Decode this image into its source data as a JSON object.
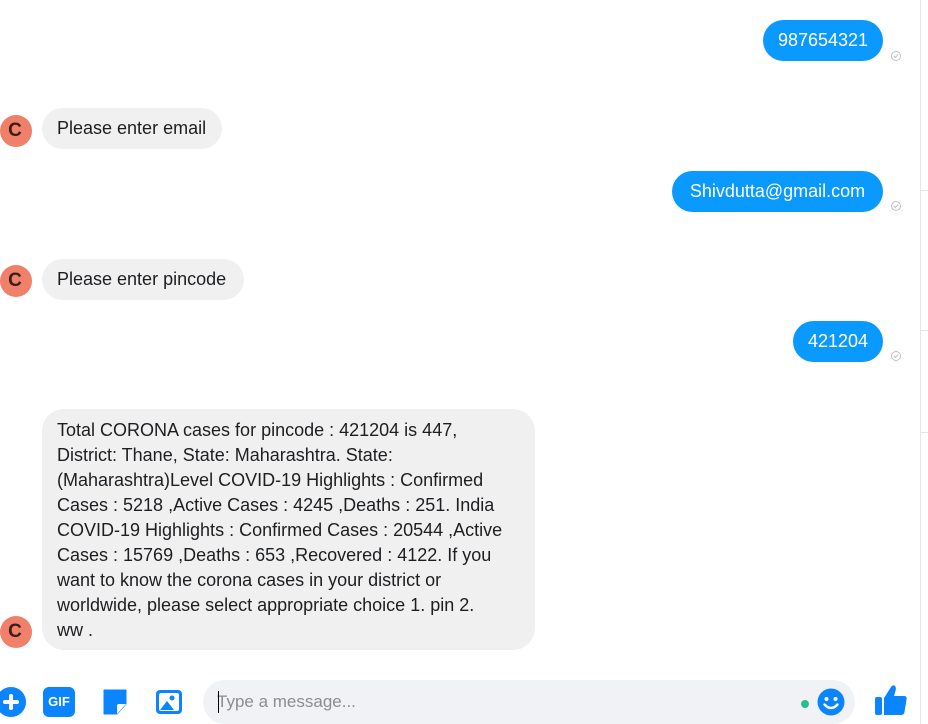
{
  "colors": {
    "accent": "#0a99ff",
    "incoming_bubble": "#f0f0f0",
    "avatar": "#f0806a",
    "online": "#2abf8a"
  },
  "contact": {
    "avatar_letter": "C"
  },
  "messages": [
    {
      "direction": "outgoing",
      "text": "987654321",
      "status_icon": "sent-check-icon"
    },
    {
      "direction": "incoming",
      "text": "Please enter email"
    },
    {
      "direction": "outgoing",
      "text": "Shivdutta@gmail.com",
      "status_icon": "sent-check-icon"
    },
    {
      "direction": "incoming",
      "text": "Please enter pincode"
    },
    {
      "direction": "outgoing",
      "text": "421204",
      "status_icon": "sent-check-icon"
    },
    {
      "direction": "incoming",
      "lines": [
        "Total CORONA cases for pincode : 421204 is 447,",
        "District: Thane, State: Maharashtra.  State:",
        "(Maharashtra)Level COVID-19 Highlights :  Confirmed",
        "Cases : 5218 ,Active Cases : 4245 ,Deaths : 251.  India",
        "COVID-19 Highlights :  Confirmed Cases : 20544 ,Active",
        "Cases : 15769 ,Deaths : 653 ,Recovered : 4122.  If you",
        "want to know the corona cases in your district or",
        "worldwide, please select appropriate choice  1. pin  2.",
        "ww  ."
      ]
    }
  ],
  "composer": {
    "placeholder": "Type a message...",
    "value": "",
    "gif_label": "GIF",
    "icons": [
      "plus-icon",
      "gif-icon",
      "sticker-icon",
      "image-icon",
      "emoji-icon",
      "thumbs-up-icon"
    ]
  }
}
